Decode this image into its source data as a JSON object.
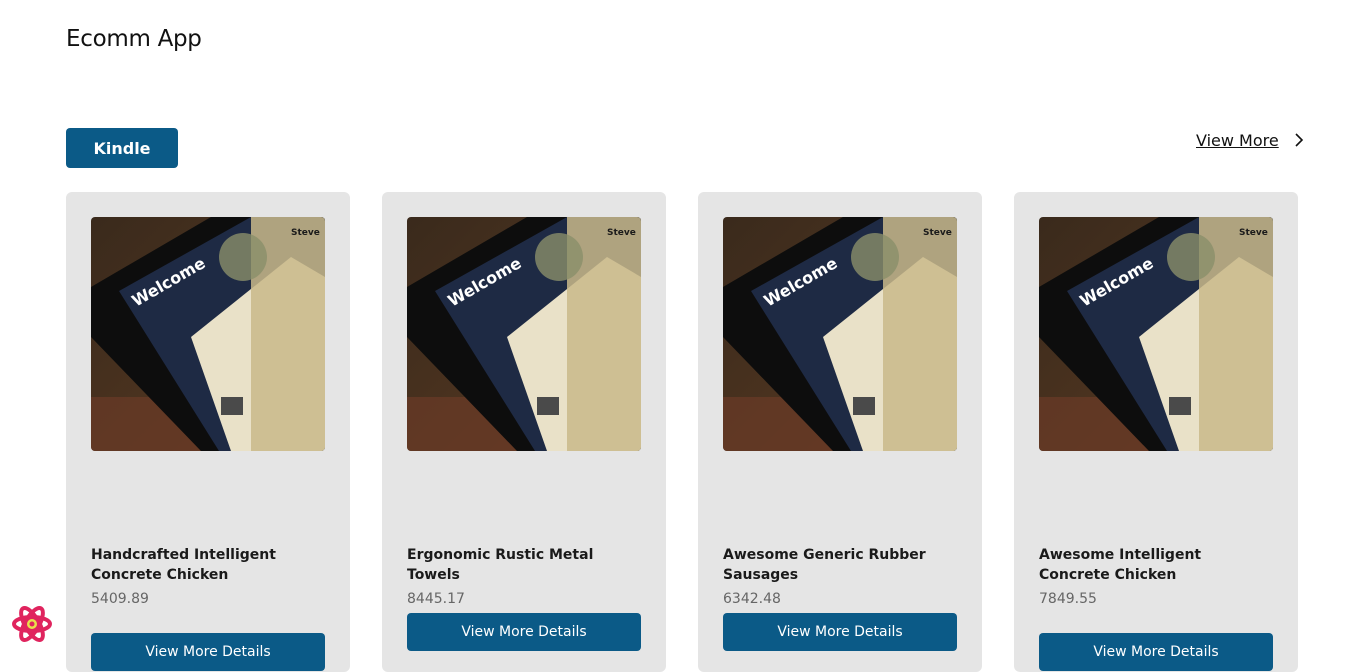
{
  "header": {
    "title": "Ecomm App"
  },
  "category": {
    "label": "Kindle"
  },
  "view_more": {
    "label": "View More",
    "icon": "chevron-right-icon"
  },
  "products": [
    {
      "name": "Handcrafted Intelligent Concrete Chicken",
      "price": "5409.89",
      "button_label": "View More Details"
    },
    {
      "name": "Ergonomic Rustic Metal Towels",
      "price": "8445.17",
      "button_label": "View More Details"
    },
    {
      "name": "Awesome Generic Rubber Sausages",
      "price": "6342.48",
      "button_label": "View More Details"
    },
    {
      "name": "Awesome Intelligent Concrete Chicken",
      "price": "7849.55",
      "button_label": "View More Details"
    }
  ],
  "product_image": {
    "heading": "Welcome",
    "sender": "Steve"
  },
  "colors": {
    "primary": "#0b5a87",
    "card_bg": "#e5e5e5",
    "react_logo": "#e0245e"
  }
}
